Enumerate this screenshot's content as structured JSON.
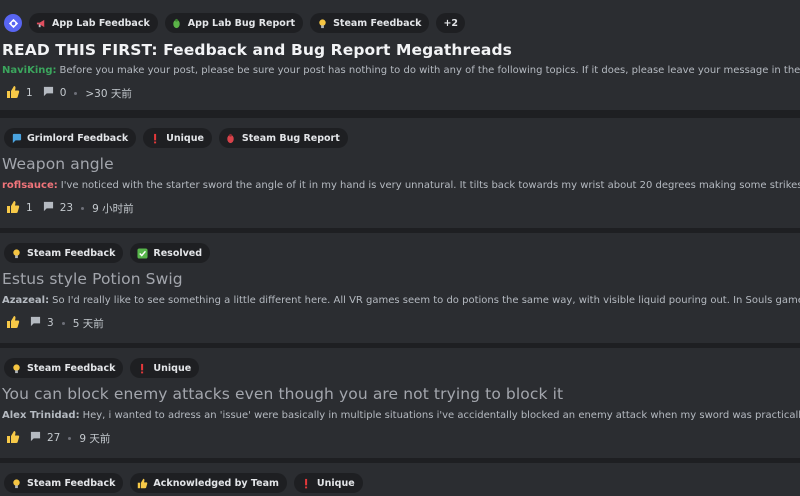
{
  "posts": [
    {
      "tags": [
        "App Lab Feedback",
        "App Lab Bug Report",
        "Steam Feedback"
      ],
      "more_tags": "+2",
      "title": "READ THIS FIRST: Feedback and Bug Report Megathreads",
      "author": "NaviKing",
      "author_color": "#3ba55d",
      "preview": "Before you make your post, please be sure your post has nothing to do with any of the following topics. If it does, please leave your message in the relevant",
      "likes": "1",
      "comments": "0",
      "time": ">30 天前"
    },
    {
      "tags": [
        "Grimlord Feedback",
        "Unique",
        "Steam Bug Report"
      ],
      "title": "Weapon angle",
      "author": "roflsauce",
      "author_color": "#f0747a",
      "preview": "I've noticed with the starter sword the angle of it in my hand is very unnatural. It tilts back towards my wrist about 20 degrees making some strikes very aw",
      "likes": "1",
      "comments": "23",
      "time": "9 小时前"
    },
    {
      "tags": [
        "Steam Feedback",
        "Resolved"
      ],
      "title": "Estus style Potion Swig",
      "author": "Azazeal",
      "author_color": "#b5bac1",
      "preview": "So I'd really like to see something a little different here. All VR games seem to do potions the same way, with visible liquid pouring out. In Souls games, you g",
      "likes": "",
      "comments": "3",
      "time": "5 天前"
    },
    {
      "tags": [
        "Steam Feedback",
        "Unique"
      ],
      "title": "You can block enemy attacks even though you are not trying to block it",
      "author": "Alex Trinidad",
      "author_color": "#b5bac1",
      "preview": "Hey, i wanted to adress an 'issue' were basically in multiple situations i've accidentally blocked an enemy attack when my sword was practically next to",
      "likes": "",
      "comments": "27",
      "time": "9 天前"
    },
    {
      "tags": [
        "Steam Feedback",
        "Acknowledged by Team",
        "Unique"
      ]
    }
  ],
  "icons": {
    "tag_icons": {
      "App Lab Feedback": "megaphone-icon",
      "App Lab Bug Report": "green-bug-icon",
      "Steam Feedback": "lightbulb-icon",
      "Grimlord Feedback": "blue-speech-icon",
      "Unique": "exclamation-icon",
      "Steam Bug Report": "red-bug-icon",
      "Resolved": "check-box-icon",
      "Acknowledged by Team": "thumbs-up-icon"
    }
  }
}
